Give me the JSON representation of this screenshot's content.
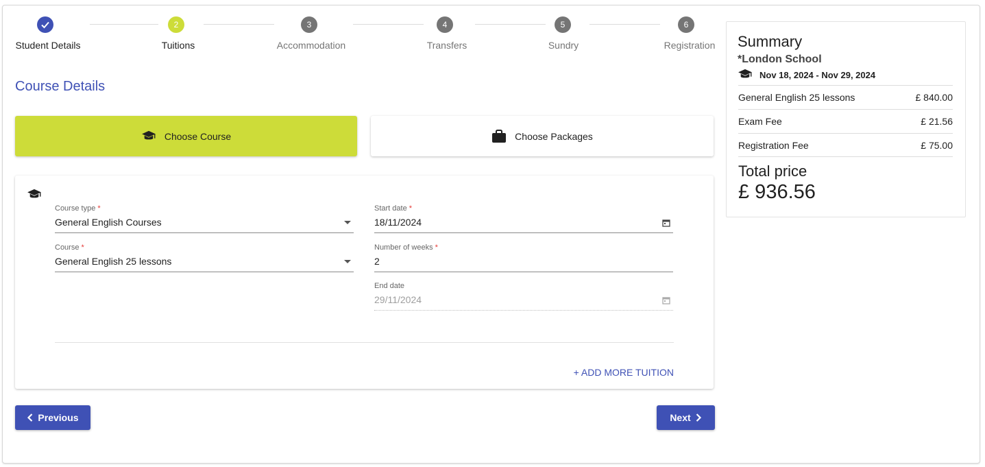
{
  "stepper": {
    "steps": [
      {
        "number": "1",
        "label": "Student Details",
        "state": "completed",
        "icon": "check-icon"
      },
      {
        "number": "2",
        "label": "Tuitions",
        "state": "active"
      },
      {
        "number": "3",
        "label": "Accommodation",
        "state": "pending"
      },
      {
        "number": "4",
        "label": "Transfers",
        "state": "pending"
      },
      {
        "number": "5",
        "label": "Sundry",
        "state": "pending"
      },
      {
        "number": "6",
        "label": "Registration",
        "state": "pending"
      }
    ]
  },
  "main": {
    "section_title": "Course Details",
    "choices": {
      "course": {
        "label": "Choose Course",
        "icon": "graduation-cap-icon",
        "selected": true
      },
      "packages": {
        "label": "Choose Packages",
        "icon": "briefcase-icon",
        "selected": false
      }
    },
    "form": {
      "course_type": {
        "label": "Course type",
        "value": "General English Courses",
        "required": true
      },
      "course": {
        "label": "Course",
        "value": "General English 25 lessons",
        "required": true
      },
      "start_date": {
        "label": "Start date",
        "value": "18/11/2024",
        "required": true
      },
      "weeks": {
        "label": "Number of weeks",
        "value": "2",
        "required": true
      },
      "end_date": {
        "label": "End date",
        "value": "29/11/2024",
        "disabled": true
      },
      "required_marker": "*"
    },
    "add_more_label": "+ ADD MORE TUITION"
  },
  "nav": {
    "previous_label": "Previous",
    "next_label": "Next"
  },
  "summary": {
    "title": "Summary",
    "school": "*London School",
    "dates": "Nov 18, 2024 - Nov 29, 2024",
    "items": [
      {
        "label": "General English 25 lessons",
        "price": "£ 840.00"
      },
      {
        "label": "Exam Fee",
        "price": "£ 21.56"
      },
      {
        "label": "Registration Fee",
        "price": "£ 75.00"
      }
    ],
    "total_label": "Total price",
    "total_value": "£ 936.56"
  },
  "colors": {
    "primary": "#3f51b5",
    "accent": "#cddc39",
    "pending": "#757575",
    "required": "#e53935"
  }
}
